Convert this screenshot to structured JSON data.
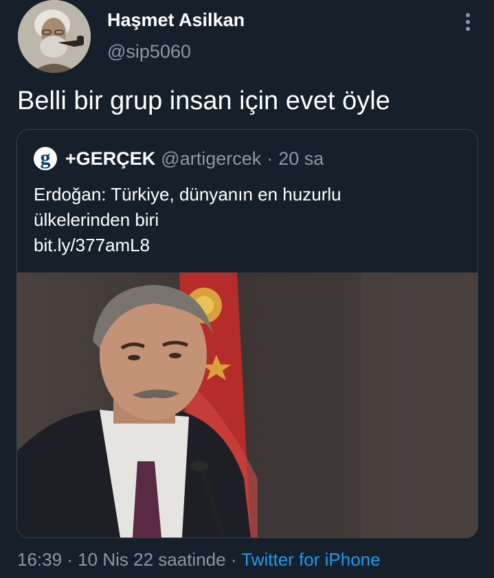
{
  "author": {
    "name": "Haşmet Asilkan",
    "handle": "@sip5060"
  },
  "tweet": {
    "text": "Belli bir grup insan için evet öyle"
  },
  "quote": {
    "logo_letter": "g",
    "name": "+GERÇEK",
    "handle": "@artigercek",
    "separator": "·",
    "time": "20 sa",
    "lines": [
      "Erdoğan: Türkiye, dünyanın en huzurlu",
      "ülkelerinden biri",
      "bit.ly/377amL8"
    ]
  },
  "meta": {
    "time": "16:39",
    "separator": "·",
    "date": "10 Nis 22 saatinde",
    "separator2": "·",
    "source": "Twitter for iPhone"
  },
  "icons": {
    "more": "more-vertical-icon"
  },
  "colors": {
    "background": "#15202b",
    "secondary_text": "#8899a6",
    "link": "#1d9bf0",
    "border": "#38444d"
  }
}
